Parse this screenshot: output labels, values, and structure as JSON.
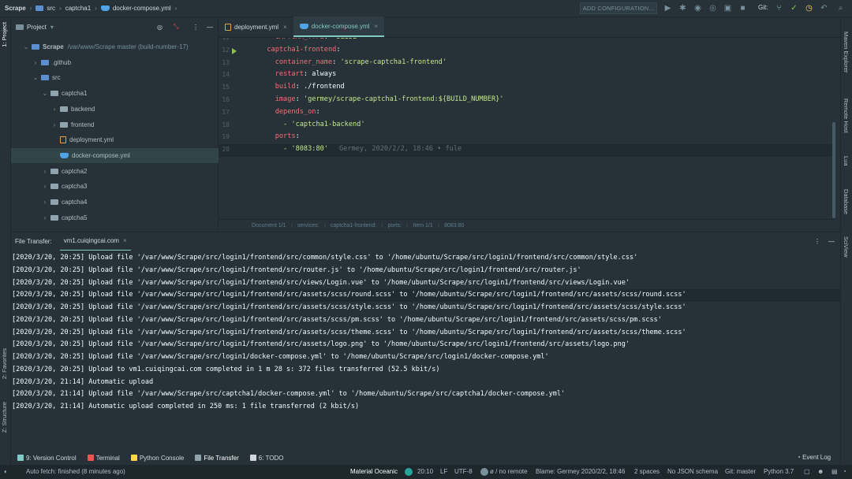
{
  "navbar": {
    "crumbs": [
      "Scrape",
      "src",
      "captcha1",
      "docker-compose.yml"
    ],
    "run_config": "ADD CONFIGURATION...",
    "git_label": "Git:"
  },
  "left_strip": {
    "project_tab": "1: Project",
    "favorites_tab": "2: Favorites",
    "structure_tab": "Z: Structure"
  },
  "project": {
    "header": "Project",
    "tree": [
      {
        "label": "Scrape",
        "detail": "/var/www/Scrape master (build-number-17)",
        "icon": "folder-icon",
        "level": 0,
        "expanded": true
      },
      {
        "label": ".github",
        "icon": "folder-icon",
        "level": 1,
        "expanded": false
      },
      {
        "label": "src",
        "icon": "folder-icon",
        "level": 1,
        "expanded": true
      },
      {
        "label": "captcha1",
        "icon": "folder-icon",
        "level": 2,
        "expanded": true
      },
      {
        "label": "backend",
        "icon": "folder-icon",
        "level": 3,
        "expanded": false
      },
      {
        "label": "frontend",
        "icon": "folder-icon",
        "level": 3,
        "expanded": false
      },
      {
        "label": "deployment.yml",
        "icon": "yaml-file-icon",
        "level": 3,
        "leaf": true
      },
      {
        "label": "docker-compose.yml",
        "icon": "docker-file-icon",
        "level": 3,
        "leaf": true,
        "selected": true
      },
      {
        "label": "captcha2",
        "icon": "folder-icon",
        "level": 2,
        "expanded": false
      },
      {
        "label": "captcha3",
        "icon": "folder-icon",
        "level": 2,
        "expanded": false
      },
      {
        "label": "captcha4",
        "icon": "folder-icon",
        "level": 2,
        "expanded": false
      },
      {
        "label": "captcha5",
        "icon": "folder-icon",
        "level": 2,
        "expanded": false
      }
    ]
  },
  "editor": {
    "tabs": [
      {
        "label": "deployment.yml",
        "active": false
      },
      {
        "label": "docker-compose.yml",
        "active": true
      }
    ],
    "lines": [
      {
        "num": "11",
        "indent": "    ",
        "key": "CAPTCHA_TYPE",
        "value": " 'SLIDE'",
        "partial": true
      },
      {
        "num": "12",
        "indent": "  ",
        "key": "captcha1-frontend",
        "value": ""
      },
      {
        "num": "13",
        "indent": "    ",
        "key": "container_name",
        "value": " 'scrape-captcha1-frontend'"
      },
      {
        "num": "14",
        "indent": "    ",
        "key": "restart",
        "value": " always"
      },
      {
        "num": "15",
        "indent": "    ",
        "key": "build",
        "value": " ./frontend"
      },
      {
        "num": "16",
        "indent": "    ",
        "key": "image",
        "value": " 'germey/scrape-captcha1-frontend:${BUILD_NUMBER}'"
      },
      {
        "num": "17",
        "indent": "    ",
        "key": "depends_on",
        "value": ""
      },
      {
        "num": "18",
        "indent": "      ",
        "key": "",
        "value": "- 'captcha1-backend'"
      },
      {
        "num": "19",
        "indent": "    ",
        "key": "ports",
        "value": ""
      },
      {
        "num": "20",
        "indent": "      ",
        "key": "",
        "value": "- '8083:80'",
        "blame": "Germey, 2020/2/2, 18:46 • fule"
      }
    ],
    "breadcrumb": [
      "Document 1/1",
      "services:",
      "captcha1-frontend:",
      "ports:",
      "Item 1/1",
      "8083:80"
    ]
  },
  "right_strip": [
    "Maven Explorer",
    "Remote Host",
    "Lua",
    "Database",
    "SciView"
  ],
  "file_transfer": {
    "label": "File Transfer:",
    "tab": "vm1.cuiqingcai.com",
    "log": [
      "[2020/3/20, 20:25] Upload file '/var/www/Scrape/src/login1/frontend/src/common/style.css' to '/home/ubuntu/Scrape/src/login1/frontend/src/common/style.css'",
      "[2020/3/20, 20:25] Upload file '/var/www/Scrape/src/login1/frontend/src/router.js' to '/home/ubuntu/Scrape/src/login1/frontend/src/router.js'",
      "[2020/3/20, 20:25] Upload file '/var/www/Scrape/src/login1/frontend/src/views/Login.vue' to '/home/ubuntu/Scrape/src/login1/frontend/src/views/Login.vue'",
      "[2020/3/20, 20:25] Upload file '/var/www/Scrape/src/login1/frontend/src/assets/scss/round.scss' to '/home/ubuntu/Scrape/src/login1/frontend/src/assets/scss/round.scss'",
      "[2020/3/20, 20:25] Upload file '/var/www/Scrape/src/login1/frontend/src/assets/scss/style.scss' to '/home/ubuntu/Scrape/src/login1/frontend/src/assets/scss/style.scss'",
      "[2020/3/20, 20:25] Upload file '/var/www/Scrape/src/login1/frontend/src/assets/scss/pm.scss' to '/home/ubuntu/Scrape/src/login1/frontend/src/assets/scss/pm.scss'",
      "[2020/3/20, 20:25] Upload file '/var/www/Scrape/src/login1/frontend/src/assets/scss/theme.scss' to '/home/ubuntu/Scrape/src/login1/frontend/src/assets/scss/theme.scss'",
      "[2020/3/20, 20:25] Upload file '/var/www/Scrape/src/login1/frontend/src/assets/logo.png' to '/home/ubuntu/Scrape/src/login1/frontend/src/assets/logo.png'",
      "[2020/3/20, 20:25] Upload file '/var/www/Scrape/src/login1/docker-compose.yml' to '/home/ubuntu/Scrape/src/login1/docker-compose.yml'",
      "[2020/3/20, 20:25] Upload to vm1.cuiqingcai.com completed in 1 m 28 s: 372 files transferred (52.5 kbit/s)",
      "[2020/3/20, 21:14] Automatic upload",
      "[2020/3/20, 21:14] Upload file '/var/www/Scrape/src/captcha1/docker-compose.yml' to '/home/ubuntu/Scrape/src/captcha1/docker-compose.yml'",
      "[2020/3/20, 21:14] Automatic upload completed in 250 ms: 1 file transferred (2 kbit/s)"
    ],
    "highlighted_line": 3
  },
  "tool_tabs": [
    {
      "label": "9: Version Control",
      "icon": "version-control-icon",
      "color": "#80cbc4"
    },
    {
      "label": "Terminal",
      "icon": "terminal-icon",
      "color": "#ef5350"
    },
    {
      "label": "Python Console",
      "icon": "python-icon",
      "color": "#ffd54f"
    },
    {
      "label": "File Transfer",
      "icon": "file-transfer-icon",
      "color": "#90a4ae",
      "active": true
    },
    {
      "label": "6: TODO",
      "icon": "todo-icon",
      "color": "#cfd8dc"
    }
  ],
  "event_log": "Event Log",
  "status": {
    "message": "Auto fetch: finished (8 minutes ago)",
    "theme": "Material Oceanic",
    "position": "20:10",
    "line_sep": "LF",
    "encoding": "UTF-8",
    "remote": "ø / no remote",
    "blame": "Blame: Germey 2020/2/2, 18:46",
    "indent": "2 spaces",
    "schema": "No JSON schema",
    "git": "Git: master",
    "python": "Python 3.7"
  },
  "colors": {
    "accent": "#80cbc4",
    "background": "#263238",
    "key": "#f07178",
    "string": "#c3e88d"
  }
}
